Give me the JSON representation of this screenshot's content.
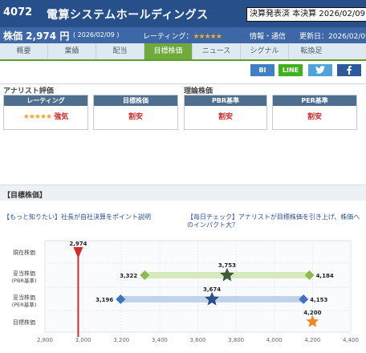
{
  "header": {
    "code": "4072",
    "company": "電算システムホールディングス",
    "kessan": "決算発表済 本決算 2026/02/09"
  },
  "subbar": {
    "price_label": "株価 2,974 円",
    "price_date": "( 2026/02/09 )",
    "rating_label": "レーティング：",
    "rating_stars": "★★★★★",
    "sector": "情報・通信",
    "updated": "更新日：2026/02/09"
  },
  "tabs": [
    "概要",
    "業績",
    "配当",
    "目標株価",
    "ニュース",
    "シグナル",
    "転換足"
  ],
  "active_tab": "目標株価",
  "share": {
    "bi": "BI",
    "line": "LINE"
  },
  "analyst": {
    "section_title": "アナリスト評価",
    "rating_header": "レーティング",
    "rating_stars": "★★★★★",
    "rating_value": "強気",
    "target_header": "目標株価",
    "target_value": "割安"
  },
  "theory": {
    "section_title": "理論株価",
    "pbr_header": "PBR基準",
    "pbr_value": "割安",
    "per_header": "PER基準",
    "per_value": "割安"
  },
  "target_section": {
    "title": "【目標株価】",
    "link1": "【もっと知りたい】社長が自社決算をポイント説明",
    "link2": "【毎日チェック】アナリストが目標株価を引き上げ、株価へのインパクト大？"
  },
  "chart_data": {
    "type": "range",
    "xlim": [
      2800,
      4400
    ],
    "x_ticks": [
      2800,
      3000,
      3200,
      3400,
      3600,
      3800,
      4000,
      4200,
      4400
    ],
    "x_tick_labels": [
      "2,800",
      "3,000",
      "3,200",
      "3,400",
      "3,600",
      "3,800",
      "4,000",
      "4,200",
      "4,400"
    ],
    "rows": [
      {
        "label": [
          "現在株価"
        ],
        "type": "current",
        "value": 2974,
        "value_label": "2,974"
      },
      {
        "label": [
          "妥当株価",
          "(PBR基準)"
        ],
        "type": "range",
        "low": 3322,
        "mid": 3753,
        "high": 4184,
        "low_label": "3,322",
        "mid_label": "3,753",
        "high_label": "4,184",
        "color": "#8dba4f",
        "bar": "#d6e8bd"
      },
      {
        "label": [
          "妥当株価",
          "(PER基準)"
        ],
        "type": "range",
        "low": 3196,
        "mid": 3674,
        "high": 4153,
        "low_label": "3,196",
        "mid_label": "3,674",
        "high_label": "4,153",
        "color": "#3d73c1",
        "bar": "#c0d3ea"
      },
      {
        "label": [
          "目標株価"
        ],
        "type": "target",
        "value": 4200,
        "value_label": "4,200",
        "color": "#ef8a23"
      }
    ]
  }
}
